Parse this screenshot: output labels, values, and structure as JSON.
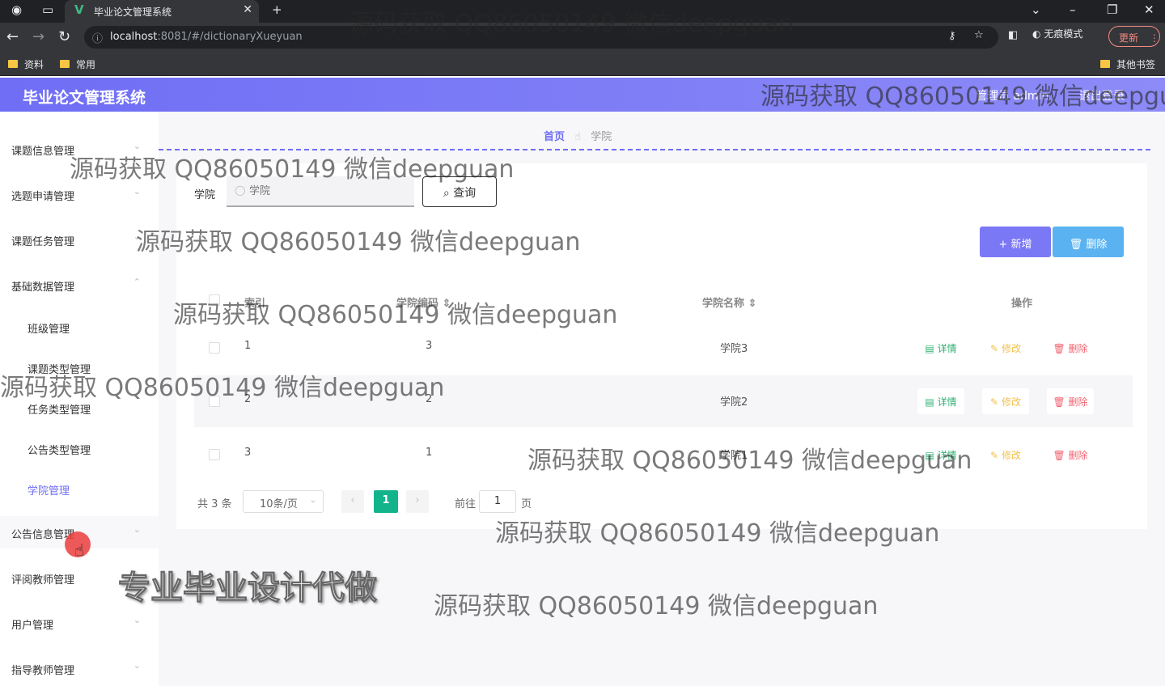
{
  "browser": {
    "tab_title": "毕业论文管理系统",
    "tab_logo": "V",
    "url_host": "localhost",
    "url_path": ":8081/#/dictionaryXueyuan",
    "incognito_label": "无痕模式",
    "update_label": "更新",
    "bookmarks": [
      "资料",
      "常用"
    ],
    "other_bookmarks": "其他书签"
  },
  "header": {
    "title": "毕业论文管理系统",
    "user_label": "管理员 admin",
    "logout_label": "退出登录"
  },
  "sidebar": {
    "menus": [
      {
        "label": "课题信息管理"
      },
      {
        "label": "选题申请管理"
      },
      {
        "label": "课题任务管理"
      },
      {
        "label": "基础数据管理"
      }
    ],
    "sub_items": [
      {
        "label": "班级管理"
      },
      {
        "label": "课题类型管理"
      },
      {
        "label": "任务类型管理"
      },
      {
        "label": "公告类型管理"
      },
      {
        "label": "学院管理"
      }
    ],
    "menus_after": [
      {
        "label": "公告信息管理"
      },
      {
        "label": "评阅教师管理"
      },
      {
        "label": "用户管理"
      },
      {
        "label": "指导教师管理"
      }
    ]
  },
  "breadcrumb": {
    "home": "首页",
    "current": "学院"
  },
  "search": {
    "label": "学院",
    "placeholder": "学院",
    "button": "查询"
  },
  "toolbar": {
    "add": "+ 新增",
    "delete": "删除"
  },
  "table": {
    "headers": {
      "index": "索引",
      "code": "学院编码",
      "name": "学院名称",
      "actions": "操作"
    },
    "rows": [
      {
        "index": "1",
        "code": "3",
        "name": "学院3"
      },
      {
        "index": "2",
        "code": "2",
        "name": "学院2"
      },
      {
        "index": "3",
        "code": "1",
        "name": "学院1"
      }
    ],
    "action_labels": {
      "detail": "详情",
      "edit": "修改",
      "delete": "删除"
    }
  },
  "pagination": {
    "total": "共 3 条",
    "page_size": "10条/页",
    "current_page": "1",
    "goto_label": "前往",
    "goto_value": "1",
    "page_label": "页"
  },
  "watermarks": {
    "text": "源码获取 QQ86050149 微信deepguan",
    "text_cut": "源码获取 QQ86050149 微信deepgu",
    "promo": "专业毕业设计代做"
  },
  "colors": {
    "accent": "#6f6ef5",
    "success": "#13b48c",
    "danger": "#f06470",
    "warning": "#f2c14e"
  }
}
